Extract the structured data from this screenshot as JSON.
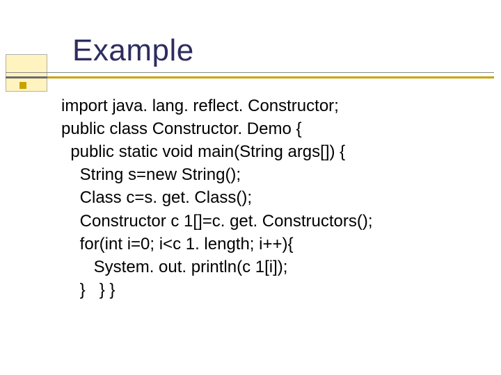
{
  "slide": {
    "title": "Example",
    "code": {
      "lines": [
        "import java. lang. reflect. Constructor;",
        "public class Constructor. Demo {",
        "  public static void main(String args[]) {",
        "    String s=new String();",
        "    Class c=s. get. Class();",
        "    Constructor c 1[]=c. get. Constructors();",
        "    for(int i=0; i<c 1. length; i++){",
        "       System. out. println(c 1[i]);",
        "    }   } }"
      ]
    }
  }
}
